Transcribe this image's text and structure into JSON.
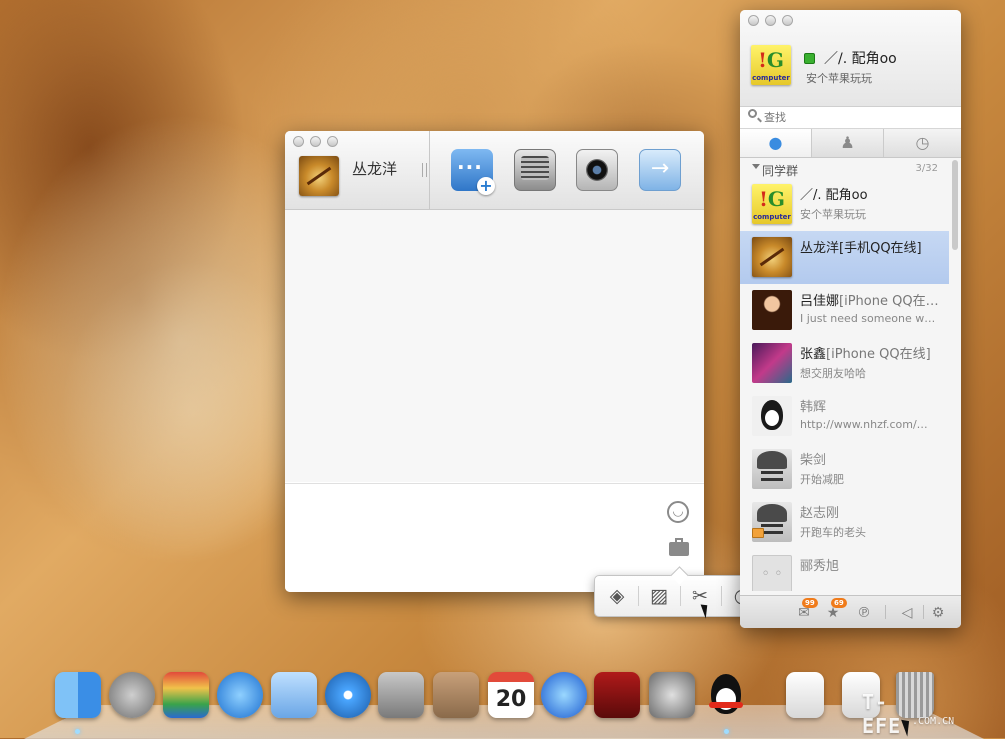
{
  "chat_window": {
    "contact_name": "丛龙洋",
    "toolbar": {
      "multi_chat_icon": "chat-bubble-plus-icon",
      "voice_icon": "microphone-icon",
      "video_icon": "camera-icon",
      "file_icon": "send-file-icon"
    },
    "input": {
      "emoji_icon": "smiley-icon",
      "toolbox_icon": "briefcase-icon"
    }
  },
  "tool_popup": {
    "items": [
      "rotate-icon",
      "image-icon",
      "screenshot-scissors-icon",
      "clock-icon"
    ]
  },
  "contact_panel": {
    "self": {
      "nickname": "／/. 配角oo",
      "signature": "安个苹果玩玩",
      "status": "online"
    },
    "search": {
      "placeholder": "查找"
    },
    "tabs": [
      "chat-bubble-icon",
      "contacts-icon",
      "recent-clock-icon"
    ],
    "group": {
      "name": "同学群",
      "count": "3/32"
    },
    "contacts": [
      {
        "name": "／/. 配角oo",
        "status": "",
        "signature": "安个苹果玩玩",
        "avatar": "ig-computer",
        "selected": false,
        "online": true
      },
      {
        "name": "丛龙洋",
        "status": "[手机QQ在线]",
        "signature": "",
        "avatar": "compass",
        "selected": true,
        "online": true
      },
      {
        "name": "吕佳娜",
        "status": "[iPhone QQ在…",
        "signature": "I just need someone wh…",
        "avatar": "girl",
        "selected": false,
        "online": true
      },
      {
        "name": "张鑫",
        "status": "[iPhone QQ在线]",
        "signature": "想交朋友哈哈",
        "avatar": "art",
        "selected": false,
        "online": true
      },
      {
        "name": "韩辉",
        "status": "",
        "signature": "http://www.nhzf.com/…",
        "avatar": "penguin",
        "selected": false,
        "online": false
      },
      {
        "name": "柴剑",
        "status": "",
        "signature": "开始减肥",
        "avatar": "anime",
        "selected": false,
        "online": false
      },
      {
        "name": "赵志刚",
        "status": "",
        "signature": "开跑车的老头",
        "avatar": "anime",
        "selected": false,
        "online": false
      },
      {
        "name": "郦秀旭",
        "status": "",
        "signature": "",
        "avatar": "blank",
        "selected": false,
        "online": false
      }
    ],
    "bottom_bar": {
      "mail_badge": "99",
      "favorites_badge": "69"
    }
  },
  "dock": {
    "apps": [
      "Finder",
      "Launchpad",
      "Photo Booth",
      "App Store",
      "Preview",
      "Safari",
      "FaceTime",
      "Contacts",
      "Calendar",
      "iTunes",
      "Photo Booth",
      "System Preferences",
      "QQ",
      "Documents",
      "Downloads",
      "Trash"
    ],
    "calendar_day": "20"
  },
  "watermark": {
    "main": "T-EFE",
    "sub": ".COM.CN"
  }
}
